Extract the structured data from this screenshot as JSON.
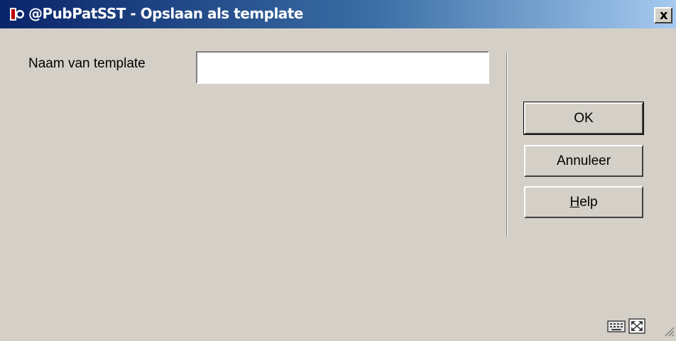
{
  "window": {
    "title": "@PubPatSST - Opslaan als template",
    "close_label": "x"
  },
  "form": {
    "name_label": "Naam van template",
    "name_value": ""
  },
  "buttons": {
    "ok": "OK",
    "cancel": "Annuleer",
    "help_underlined": "H",
    "help_rest": "elp"
  },
  "status_icons": [
    "keyboard-icon",
    "maximize-icon",
    "resize-grip-icon"
  ]
}
